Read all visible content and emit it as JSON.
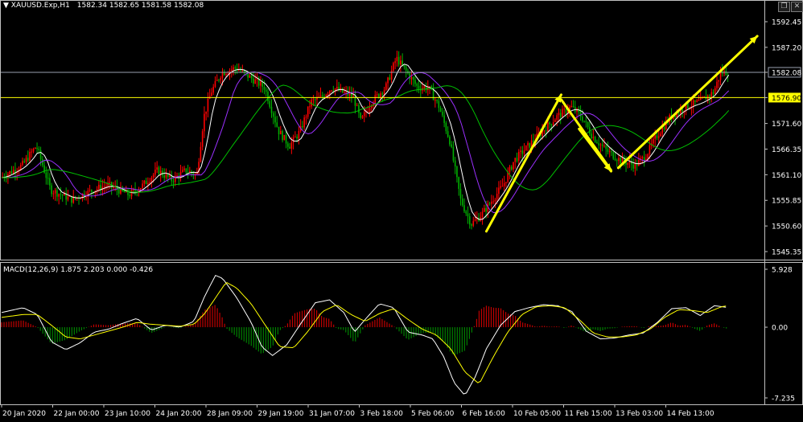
{
  "header": {
    "symbol_label": "XAUUSD.Exp,H1",
    "ohlc": "1582.34 1582.65 1581.58 1582.08"
  },
  "macd_header": "MACD(12,26,9) 1.875 2.203 0.000 -0.426",
  "window_controls": {
    "restore": "❐",
    "close": "✕"
  },
  "colors": {
    "background": "#000000",
    "grid_border": "#c0c0c0",
    "bull_candle": "#ff0000",
    "bear_candle": "#00b000",
    "level_line": "#ffff00",
    "current_price_line": "#9aa0b0",
    "fast_ma": "#ffffff",
    "mid_ma": "#9b30ff",
    "slow_ma": "#00c000",
    "arrows": "#ffff00",
    "macd_line": "#ffffff",
    "signal_line": "#ffff00",
    "hist_pos": "#c00000",
    "hist_neg": "#008000"
  },
  "chart_data": [
    {
      "type": "candlestick",
      "name": "XAUUSD.Exp,H1",
      "ylim": [
        1545.35,
        1592.45
      ],
      "y_ticks": [
        "1592.45",
        "1587.20",
        "1582.08",
        "1576.90",
        "1571.60",
        "1566.35",
        "1561.10",
        "1555.85",
        "1550.60",
        "1545.35"
      ],
      "x_ticks": [
        "20 Jan 2020",
        "22 Jan 00:00",
        "23 Jan 10:00",
        "24 Jan 20:00",
        "28 Jan 09:00",
        "29 Jan 19:00",
        "31 Jan 07:00",
        "3 Feb 18:00",
        "5 Feb 06:00",
        "6 Feb 16:00",
        "10 Feb 05:00",
        "11 Feb 15:00",
        "13 Feb 03:00",
        "14 Feb 13:00"
      ],
      "current_price": "1582.08",
      "horizontal_level": "1576.90",
      "price_path": [
        [
          0,
          1560.5
        ],
        [
          3,
          1563
        ],
        [
          5,
          1567
        ],
        [
          7,
          1558
        ],
        [
          10,
          1556
        ],
        [
          13,
          1558
        ],
        [
          15,
          1559
        ],
        [
          18,
          1557
        ],
        [
          20,
          1559
        ],
        [
          22,
          1562
        ],
        [
          24,
          1560
        ],
        [
          26,
          1562
        ],
        [
          27.5,
          1561
        ],
        [
          28.5,
          1573
        ],
        [
          29.5,
          1578
        ],
        [
          31,
          1582
        ],
        [
          33,
          1583
        ],
        [
          35,
          1581
        ],
        [
          37,
          1579
        ],
        [
          39,
          1570
        ],
        [
          40.5,
          1567
        ],
        [
          42,
          1570
        ],
        [
          43.5,
          1576
        ],
        [
          45,
          1577
        ],
        [
          46.5,
          1579
        ],
        [
          48,
          1578
        ],
        [
          49.5,
          1577
        ],
        [
          50.5,
          1572
        ],
        [
          52,
          1576
        ],
        [
          54,
          1579
        ],
        [
          55.5,
          1585
        ],
        [
          57,
          1582
        ],
        [
          58.5,
          1579
        ],
        [
          60,
          1579
        ],
        [
          61.5,
          1575
        ],
        [
          63,
          1568
        ],
        [
          64.5,
          1556
        ],
        [
          66,
          1551
        ],
        [
          67.5,
          1553
        ],
        [
          69,
          1556
        ],
        [
          70.5,
          1559
        ],
        [
          72,
          1564
        ],
        [
          74,
          1567
        ],
        [
          76,
          1570
        ],
        [
          78,
          1573
        ],
        [
          80,
          1575
        ],
        [
          81.5,
          1573
        ],
        [
          83,
          1569
        ],
        [
          85,
          1566
        ],
        [
          87,
          1564
        ],
        [
          89,
          1563
        ],
        [
          90.5,
          1565
        ],
        [
          92,
          1569
        ],
        [
          94,
          1573
        ],
        [
          96,
          1575
        ],
        [
          98,
          1576
        ],
        [
          100,
          1578
        ],
        [
          101,
          1582
        ],
        [
          102,
          1582.1
        ]
      ],
      "annotations": [
        {
          "type": "arrow",
          "from": [
            68,
            1549.5
          ],
          "to": [
            78.5,
            1577.5
          ]
        },
        {
          "type": "line",
          "from": [
            78.5,
            1576.5
          ],
          "to": [
            85.5,
            1562
          ]
        },
        {
          "type": "arrow",
          "from": [
            81,
            1570.5
          ],
          "to": [
            85.5,
            1561.8
          ]
        },
        {
          "type": "arrow",
          "from": [
            86.5,
            1562.5
          ],
          "to": [
            106,
            1589.5
          ]
        }
      ]
    },
    {
      "type": "macd",
      "name": "MACD(12,26,9)",
      "values": {
        "macd": "1.875",
        "signal": "2.203",
        "histogram": "0.000",
        "osma": "-0.426"
      },
      "ylim": [
        -7.235,
        5.928
      ],
      "y_ticks": [
        "5.928",
        "0.00",
        "-7.235"
      ],
      "macd_path": [
        [
          0,
          1.5
        ],
        [
          3,
          2.0
        ],
        [
          5,
          1.3
        ],
        [
          7,
          -1.5
        ],
        [
          9,
          -2.3
        ],
        [
          11,
          -1.6
        ],
        [
          13,
          -0.5
        ],
        [
          15,
          -0.2
        ],
        [
          17,
          0.4
        ],
        [
          19,
          0.9
        ],
        [
          21,
          -0.3
        ],
        [
          23,
          0.2
        ],
        [
          25,
          0.0
        ],
        [
          27,
          0.6
        ],
        [
          28.5,
          3.2
        ],
        [
          30,
          5.3
        ],
        [
          31,
          5.0
        ],
        [
          33,
          3.0
        ],
        [
          35,
          0.5
        ],
        [
          36.5,
          -2.0
        ],
        [
          38,
          -2.9
        ],
        [
          40,
          -1.8
        ],
        [
          42,
          0.4
        ],
        [
          44,
          2.5
        ],
        [
          46,
          2.8
        ],
        [
          48,
          1.5
        ],
        [
          49.5,
          -0.5
        ],
        [
          51,
          0.8
        ],
        [
          53,
          2.4
        ],
        [
          55,
          2.0
        ],
        [
          57,
          -0.5
        ],
        [
          59,
          -0.8
        ],
        [
          60.5,
          -1.2
        ],
        [
          62,
          -3.0
        ],
        [
          63.5,
          -5.7
        ],
        [
          65,
          -7.0
        ],
        [
          66.5,
          -5.0
        ],
        [
          68,
          -2.2
        ],
        [
          70,
          0.2
        ],
        [
          72,
          1.6
        ],
        [
          74,
          2.0
        ],
        [
          76,
          2.3
        ],
        [
          78,
          2.2
        ],
        [
          80,
          1.6
        ],
        [
          82,
          -0.4
        ],
        [
          84,
          -1.2
        ],
        [
          86,
          -1.1
        ],
        [
          88,
          -0.8
        ],
        [
          90,
          -0.6
        ],
        [
          92,
          0.5
        ],
        [
          94,
          1.9
        ],
        [
          96,
          2.0
        ],
        [
          98,
          1.2
        ],
        [
          100,
          2.2
        ],
        [
          102,
          2.0
        ]
      ],
      "signal_path": [
        [
          0,
          1.0
        ],
        [
          3,
          1.3
        ],
        [
          5,
          1.3
        ],
        [
          7,
          0.2
        ],
        [
          9,
          -1.0
        ],
        [
          11,
          -1.2
        ],
        [
          13,
          -0.8
        ],
        [
          15,
          -0.4
        ],
        [
          17,
          0.0
        ],
        [
          19,
          0.5
        ],
        [
          21,
          0.3
        ],
        [
          23,
          0.2
        ],
        [
          25,
          0.1
        ],
        [
          27,
          0.3
        ],
        [
          28.5,
          1.4
        ],
        [
          30,
          3.0
        ],
        [
          31.5,
          4.6
        ],
        [
          33,
          4.0
        ],
        [
          35,
          2.4
        ],
        [
          37,
          0.2
        ],
        [
          39,
          -2.0
        ],
        [
          41,
          -2.1
        ],
        [
          43,
          -0.4
        ],
        [
          45,
          1.6
        ],
        [
          47,
          2.3
        ],
        [
          49,
          1.3
        ],
        [
          51,
          0.6
        ],
        [
          53,
          1.4
        ],
        [
          55,
          1.9
        ],
        [
          57,
          0.8
        ],
        [
          59,
          -0.2
        ],
        [
          61,
          -0.8
        ],
        [
          63,
          -2.2
        ],
        [
          65,
          -4.6
        ],
        [
          67,
          -5.8
        ],
        [
          69,
          -3.0
        ],
        [
          71,
          -0.5
        ],
        [
          73,
          1.3
        ],
        [
          75,
          2.1
        ],
        [
          77,
          2.2
        ],
        [
          79,
          2.0
        ],
        [
          81,
          0.8
        ],
        [
          83,
          -0.6
        ],
        [
          85,
          -1.0
        ],
        [
          87,
          -1.0
        ],
        [
          89,
          -0.8
        ],
        [
          91,
          -0.2
        ],
        [
          93,
          1.0
        ],
        [
          95,
          1.8
        ],
        [
          97,
          1.7
        ],
        [
          99,
          1.5
        ],
        [
          101,
          2.1
        ],
        [
          102,
          2.2
        ]
      ]
    }
  ]
}
